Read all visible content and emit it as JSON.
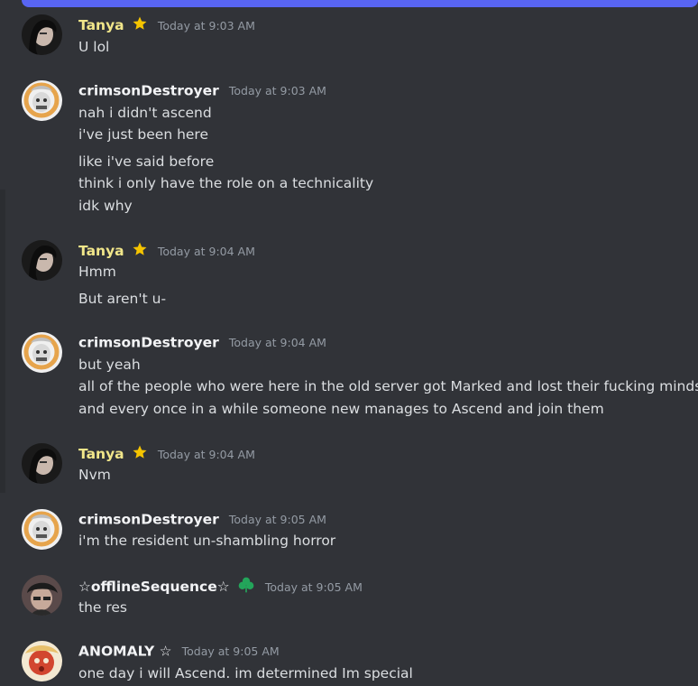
{
  "colors": {
    "background": "#313338",
    "tanya_name": "#f1e68a",
    "default_name": "#f2f3f5",
    "timestamp": "#949ba4",
    "message_text": "#dbdee1",
    "star": "#f5c400",
    "badge_green": "#23a55a"
  },
  "messages": [
    {
      "username": "Tanya",
      "badge_icon": "star-icon",
      "timestamp": "Today at 9:03 AM",
      "lines": [
        "U lol"
      ]
    },
    {
      "username": "crimsonDestroyer",
      "timestamp": "Today at 9:03 AM",
      "lines": [
        "nah i didn't ascend",
        "i've just been here",
        "like i've said before",
        "think i only have the role on a technicality",
        "idk why"
      ]
    },
    {
      "username": "Tanya",
      "badge_icon": "star-icon",
      "timestamp": "Today at 9:04 AM",
      "lines": [
        "Hmm",
        "But aren't u-"
      ]
    },
    {
      "username": "crimsonDestroyer",
      "timestamp": "Today at 9:04 AM",
      "lines": [
        "but yeah",
        "all of the people who were here in the old server got Marked and lost their fucking minds",
        "and every once in a while someone new manages to Ascend and join them"
      ]
    },
    {
      "username": "Tanya",
      "badge_icon": "star-icon",
      "timestamp": "Today at 9:04 AM",
      "lines": [
        "Nvm"
      ]
    },
    {
      "username": "crimsonDestroyer",
      "timestamp": "Today at 9:05 AM",
      "lines": [
        "i'm the resident un-shambling horror"
      ]
    },
    {
      "username": "☆offlineSequence☆",
      "badge_icon": "clover-icon",
      "timestamp": "Today at 9:05 AM",
      "lines": [
        "the res"
      ]
    },
    {
      "username": "ANOMALY ☆",
      "timestamp": "Today at 9:05 AM",
      "lines": [
        "one day i will Ascend. im determined Im special"
      ]
    }
  ]
}
